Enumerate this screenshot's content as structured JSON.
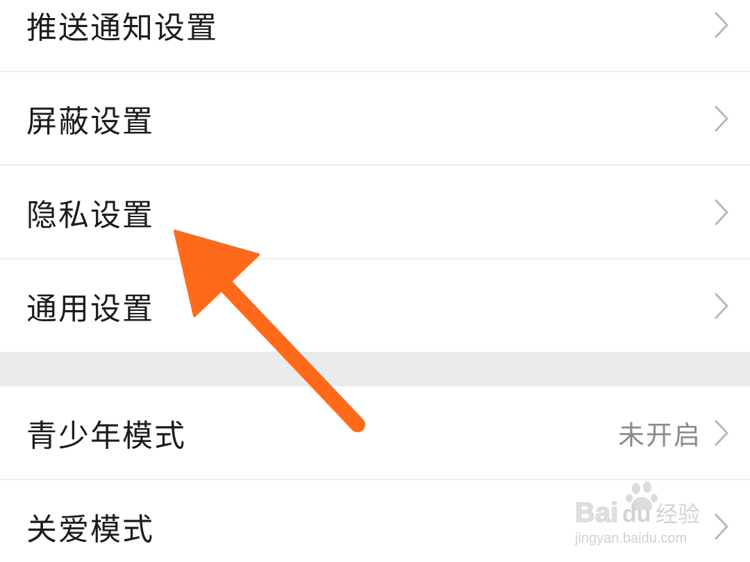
{
  "settings_list": {
    "items": [
      {
        "label": "推送通知设置",
        "value": ""
      },
      {
        "label": "屏蔽设置",
        "value": ""
      },
      {
        "label": "隐私设置",
        "value": ""
      },
      {
        "label": "通用设置",
        "value": ""
      },
      {
        "label": "青少年模式",
        "value": "未开启"
      },
      {
        "label": "关爱模式",
        "value": ""
      }
    ]
  },
  "annotation": {
    "arrow_color": "#ff6a1a",
    "points_to": "隐私设置"
  },
  "watermark": {
    "brand": "Baidu经验",
    "url": "jingyan.baidu.com"
  },
  "icons": {
    "chevron": "chevron-right-icon",
    "arrow": "annotation-arrow-icon",
    "paw": "baidu-paw-icon"
  }
}
